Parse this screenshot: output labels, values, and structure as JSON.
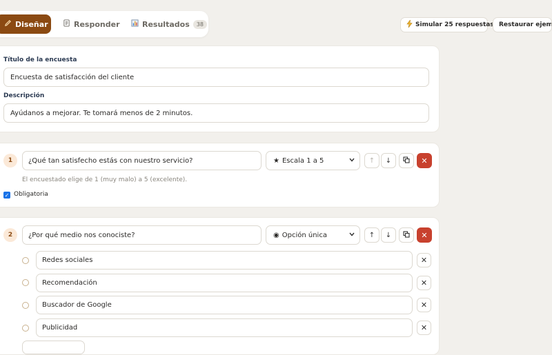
{
  "tabs": [
    {
      "label": "Diseñar",
      "icon": "pencil-icon",
      "active": true
    },
    {
      "label": "Responder",
      "icon": "document-icon",
      "active": false
    },
    {
      "label": "Resultados",
      "icon": "bar-chart-icon",
      "active": false,
      "badge": "38"
    }
  ],
  "toolbar": {
    "simulate_label": "Simular 25 respuestas",
    "restore_label": "Restaurar ejemplo"
  },
  "survey": {
    "title_label": "Título de la encuesta",
    "title_value": "Encuesta de satisfacción del cliente",
    "description_label": "Descripción",
    "description_value": "Ayúdanos a mejorar. Te tomará menos de 2 minutos."
  },
  "questions": [
    {
      "number": "1",
      "text": "¿Qué tan satisfecho estás con nuestro servicio?",
      "type_label": "Escala 1 a 5",
      "type_icon": "star-icon",
      "hint": "El encuestado elige de 1 (muy malo) a 5 (excelente).",
      "required_label": "Obligatoria",
      "required": true
    },
    {
      "number": "2",
      "text": "¿Por qué medio nos conociste?",
      "type_label": "Opción única",
      "type_icon": "radio-icon",
      "options": [
        "Redes sociales",
        "Recomendación",
        "Buscador de Google",
        "Publicidad"
      ]
    }
  ],
  "colors": {
    "accent": "#8b4a12",
    "danger": "#c8412e",
    "background": "#f2f0ec"
  }
}
